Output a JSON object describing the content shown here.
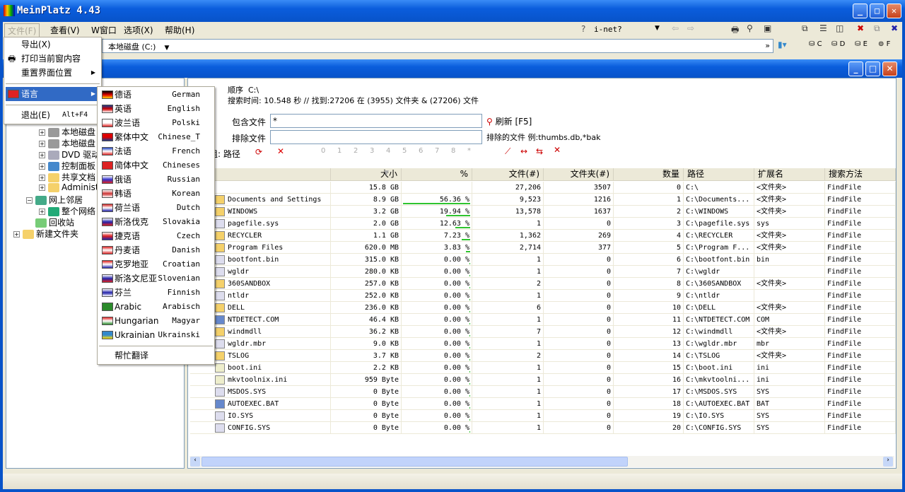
{
  "app": {
    "title": "MeinPlatz 4.43"
  },
  "menubar": [
    "文件(F)",
    "查看(V)",
    "W窗口",
    "选项(X)",
    "帮助(H)"
  ],
  "toolbar": {
    "inet_label": "i-net?",
    "address": "本地磁盘 (C:)",
    "drives": [
      "C",
      "D",
      "E",
      "F"
    ]
  },
  "file_menu": {
    "items": [
      {
        "label": "导出(X)"
      },
      {
        "label": "打印当前窗内容"
      },
      {
        "label": "重置界面位置"
      },
      {
        "label": "语言"
      },
      {
        "label": "退出(E)",
        "shortcut": "Alt+F4"
      }
    ]
  },
  "lang_menu": {
    "items": [
      {
        "label": "德语",
        "en": "German",
        "flag": [
          "#000",
          "#d00",
          "#fc0"
        ]
      },
      {
        "label": "英语",
        "en": "English",
        "flag": [
          "#1a3a8a",
          "#c00",
          "#fff"
        ]
      },
      {
        "label": "波兰语",
        "en": "Polski",
        "flag": [
          "#fff",
          "#fff",
          "#d22"
        ]
      },
      {
        "label": "繁体中文",
        "en": "Chinese_T",
        "flag": [
          "#d00",
          "#d00",
          "#1a3a8a"
        ]
      },
      {
        "label": "法语",
        "en": "French",
        "flag": [
          "#2244bb",
          "#fff",
          "#d22"
        ]
      },
      {
        "label": "简体中文",
        "en": "Chineses",
        "flag": [
          "#d22",
          "#d22",
          "#d22"
        ]
      },
      {
        "label": "俄语",
        "en": "Russian",
        "flag": [
          "#fff",
          "#33c",
          "#d22"
        ]
      },
      {
        "label": "韩语",
        "en": "Korean",
        "flag": [
          "#fff",
          "#c33",
          "#fff"
        ]
      },
      {
        "label": "荷兰语",
        "en": "Dutch",
        "flag": [
          "#c22",
          "#fff",
          "#22a"
        ]
      },
      {
        "label": "斯洛伐克",
        "en": "Slovakia",
        "flag": [
          "#fff",
          "#22a",
          "#d22"
        ]
      },
      {
        "label": "捷克语",
        "en": "Czech",
        "flag": [
          "#fff",
          "#d22",
          "#22a"
        ]
      },
      {
        "label": "丹麦语",
        "en": "Danish",
        "flag": [
          "#d22",
          "#fff",
          "#d22"
        ]
      },
      {
        "label": "克罗地亚",
        "en": "Croatian",
        "flag": [
          "#d22",
          "#fff",
          "#22a"
        ]
      },
      {
        "label": "斯洛文尼亚",
        "en": "Slovenian",
        "flag": [
          "#fff",
          "#22a",
          "#d22"
        ]
      },
      {
        "label": "芬兰",
        "en": "Finnish",
        "flag": [
          "#fff",
          "#22a",
          "#fff"
        ]
      },
      {
        "label": "Arabic",
        "en": "Arabisch",
        "flag": [
          "#2a8a2a",
          "#2a8a2a",
          "#2a8a2a"
        ]
      },
      {
        "label": "Hungarian",
        "en": "Magyar",
        "flag": [
          "#d22",
          "#fff",
          "#2a8a2a"
        ]
      },
      {
        "label": "Ukrainian",
        "en": "Ukrainski",
        "flag": [
          "#38c",
          "#38c",
          "#fd0"
        ]
      }
    ],
    "help_translate": "帮忙翻译"
  },
  "tree": [
    {
      "label": "本地磁盘 (I",
      "indent": 2,
      "icon": "drive"
    },
    {
      "label": "本地磁盘 (I",
      "indent": 2,
      "icon": "drive"
    },
    {
      "label": "DVD 驱动器",
      "indent": 2,
      "icon": "dvd"
    },
    {
      "label": "控制面板",
      "indent": 2,
      "icon": "control"
    },
    {
      "label": "共享文档",
      "indent": 2,
      "icon": "folder"
    },
    {
      "label": "Administrat",
      "indent": 2,
      "icon": "folder"
    },
    {
      "label": "网上邻居",
      "indent": 1,
      "icon": "network",
      "expanded": true
    },
    {
      "label": "整个网络",
      "indent": 2,
      "icon": "globe"
    },
    {
      "label": "回收站",
      "indent": 1,
      "icon": "recycle",
      "noexp": true
    },
    {
      "label": "新建文件夹",
      "indent": 0,
      "icon": "folder"
    }
  ],
  "search": {
    "order_label": "顺序",
    "order_value": "C:\\",
    "time_line": "搜索时间: 10.548 秒 //  找到:27206 在 (3955) 文件夹 & (27206) 文件",
    "include_label": "包含文件",
    "include_value": "*",
    "exclude_label": "排除文件",
    "exclude_value": "",
    "refresh": "刷新 [F5]",
    "exclude_hint": "排除的文件 例:thumbs.db,*bak",
    "group_label": "组: 路径",
    "levels": [
      "0",
      "1",
      "2",
      "3",
      "4",
      "5",
      "6",
      "7",
      "8",
      "*"
    ]
  },
  "table": {
    "columns": [
      "",
      "大小",
      "%",
      "文件(#)",
      "文件夹(#)",
      "数量",
      "路径",
      "扩展名",
      "搜索方法"
    ],
    "rows": [
      [
        "C:\\",
        "root",
        "15.8 GB",
        "",
        null,
        "27,206",
        "3507",
        "0",
        "C:\\",
        "<文件夹>",
        "FindFile"
      ],
      [
        "Documents and Settings",
        "folder",
        "8.9 GB",
        "56.36 %",
        56.36,
        "9,523",
        "1216",
        "1",
        "C:\\Documents...",
        "<文件夹>",
        "FindFile"
      ],
      [
        "WINDOWS",
        "folder",
        "3.2 GB",
        "19.94 %",
        19.94,
        "13,578",
        "1637",
        "2",
        "C:\\WINDOWS",
        "<文件夹>",
        "FindFile"
      ],
      [
        "pagefile.sys",
        "file",
        "2.0 GB",
        "12.63 %",
        12.63,
        "1",
        "0",
        "3",
        "C:\\pagefile.sys",
        "sys",
        "FindFile"
      ],
      [
        "RECYCLER",
        "folder",
        "1.1 GB",
        "7.23 %",
        7.23,
        "1,362",
        "269",
        "4",
        "C:\\RECYCLER",
        "<文件夹>",
        "FindFile"
      ],
      [
        "Program Files",
        "folder",
        "620.0 MB",
        "3.83 %",
        3.83,
        "2,714",
        "377",
        "5",
        "C:\\Program F...",
        "<文件夹>",
        "FindFile"
      ],
      [
        "bootfont.bin",
        "file",
        "315.0 KB",
        "0.00 %",
        0,
        "1",
        "0",
        "6",
        "C:\\bootfont.bin",
        "bin",
        "FindFile"
      ],
      [
        "wgldr",
        "file",
        "280.0 KB",
        "0.00 %",
        0,
        "1",
        "0",
        "7",
        "C:\\wgldr",
        "",
        "FindFile"
      ],
      [
        "360SANDBOX",
        "folder",
        "257.0 KB",
        "0.00 %",
        0,
        "2",
        "0",
        "8",
        "C:\\360SANDBOX",
        "<文件夹>",
        "FindFile"
      ],
      [
        "ntldr",
        "file",
        "252.0 KB",
        "0.00 %",
        0,
        "1",
        "0",
        "9",
        "C:\\ntldr",
        "",
        "FindFile"
      ],
      [
        "DELL",
        "folder",
        "236.0 KB",
        "0.00 %",
        0,
        "6",
        "0",
        "10",
        "C:\\DELL",
        "<文件夹>",
        "FindFile"
      ],
      [
        "NTDETECT.COM",
        "app",
        "46.4 KB",
        "0.00 %",
        0,
        "1",
        "0",
        "11",
        "C:\\NTDETECT.COM",
        "COM",
        "FindFile"
      ],
      [
        "windmdll",
        "folder",
        "36.2 KB",
        "0.00 %",
        0,
        "7",
        "0",
        "12",
        "C:\\windmdll",
        "<文件夹>",
        "FindFile"
      ],
      [
        "wgldr.mbr",
        "file",
        "9.0 KB",
        "0.00 %",
        0,
        "1",
        "0",
        "13",
        "C:\\wgldr.mbr",
        "mbr",
        "FindFile"
      ],
      [
        "TSLOG",
        "folder",
        "3.7 KB",
        "0.00 %",
        0,
        "2",
        "0",
        "14",
        "C:\\TSLOG",
        "<文件夹>",
        "FindFile"
      ],
      [
        "boot.ini",
        "ini",
        "2.2 KB",
        "0.00 %",
        0,
        "1",
        "0",
        "15",
        "C:\\boot.ini",
        "ini",
        "FindFile"
      ],
      [
        "mkvtoolnix.ini",
        "ini",
        "959 Byte",
        "0.00 %",
        0,
        "1",
        "0",
        "16",
        "C:\\mkvtoolni...",
        "ini",
        "FindFile"
      ],
      [
        "MSDOS.SYS",
        "file",
        "0 Byte",
        "0.00 %",
        0,
        "1",
        "0",
        "17",
        "C:\\MSDOS.SYS",
        "SYS",
        "FindFile"
      ],
      [
        "AUTOEXEC.BAT",
        "app",
        "0 Byte",
        "0.00 %",
        0,
        "1",
        "0",
        "18",
        "C:\\AUTOEXEC.BAT",
        "BAT",
        "FindFile"
      ],
      [
        "IO.SYS",
        "file",
        "0 Byte",
        "0.00 %",
        0,
        "1",
        "0",
        "19",
        "C:\\IO.SYS",
        "SYS",
        "FindFile"
      ],
      [
        "CONFIG.SYS",
        "file",
        "0 Byte",
        "0.00 %",
        0,
        "1",
        "0",
        "20",
        "C:\\CONFIG.SYS",
        "SYS",
        "FindFile"
      ]
    ]
  },
  "colors": {
    "titlebar": "#0a5ddc",
    "highlight": "#316ac5",
    "pct_bar": "#2fc42f"
  }
}
